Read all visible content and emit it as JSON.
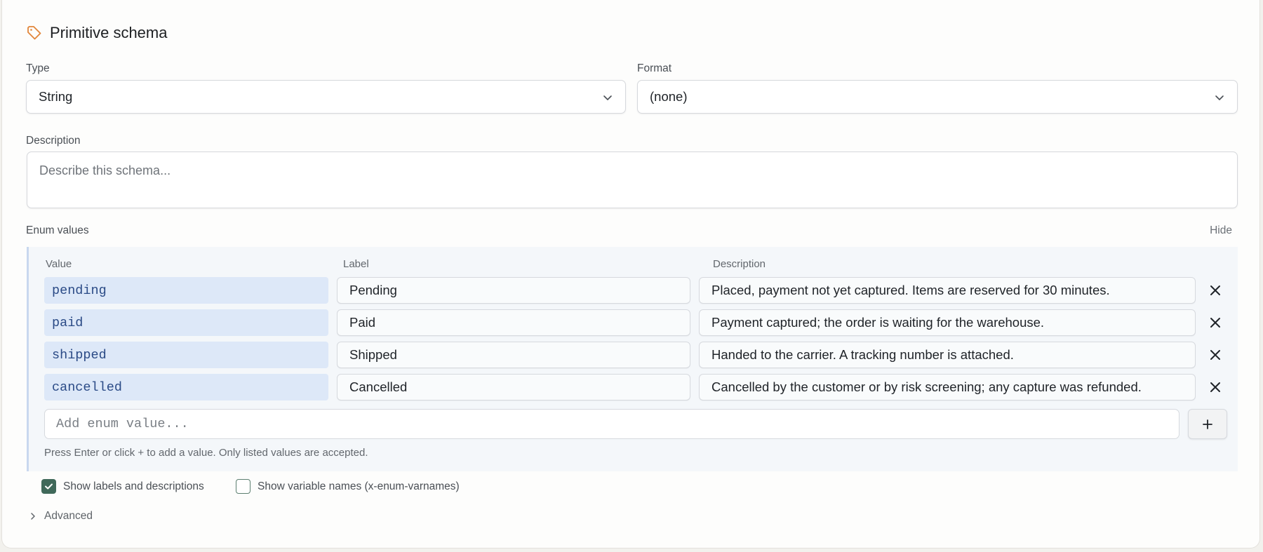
{
  "header": {
    "title": "Primitive schema",
    "icon": "tag-icon",
    "accent": "#e2863a"
  },
  "type_field": {
    "label": "Type",
    "value": "String"
  },
  "format_field": {
    "label": "Format",
    "value": "(none)"
  },
  "description_field": {
    "label": "Description",
    "placeholder": "Describe this schema..."
  },
  "enum_section": {
    "label": "Enum values",
    "hide_label": "Hide",
    "columns": {
      "value": "Value",
      "label": "Label",
      "description": "Description"
    },
    "rows": [
      {
        "value": "pending",
        "label": "Pending",
        "description": "Placed, payment not yet captured. Items are reserved for 30 minutes."
      },
      {
        "value": "paid",
        "label": "Paid",
        "description": "Payment captured; the order is waiting for the warehouse."
      },
      {
        "value": "shipped",
        "label": "Shipped",
        "description": "Handed to the carrier. A tracking number is attached."
      },
      {
        "value": "cancelled",
        "label": "Cancelled",
        "description": "Cancelled by the customer or by risk screening; any capture was refunded."
      }
    ],
    "add_placeholder": "Add enum value...",
    "hint": "Press Enter or click + to add a value. Only listed values are accepted."
  },
  "options": {
    "show_labels": {
      "label": "Show labels and descriptions",
      "checked": true
    },
    "show_varnames": {
      "label": "Show variable names (x-enum-varnames)",
      "checked": false
    }
  },
  "advanced": {
    "label": "Advanced"
  }
}
